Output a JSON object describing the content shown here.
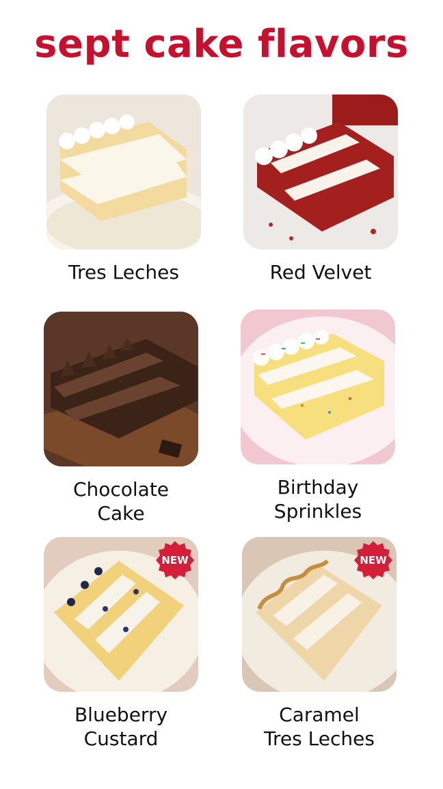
{
  "header": {
    "title": "sept cake flavors"
  },
  "flavors": [
    {
      "line1": "Tres Leches",
      "line2": "",
      "badge": ""
    },
    {
      "line1": "Red Velvet",
      "line2": "",
      "badge": ""
    },
    {
      "line1": "Chocolate",
      "line2": "Cake",
      "badge": ""
    },
    {
      "line1": "Birthday",
      "line2": "Sprinkles",
      "badge": ""
    },
    {
      "line1": "Blueberry",
      "line2": "Custard",
      "badge": "NEW"
    },
    {
      "line1": "Caramel",
      "line2": "Tres Leches",
      "badge": "NEW"
    }
  ],
  "colors": {
    "brand_red": "#c8102e",
    "badge_red": "#d41f3a",
    "text": "#111111"
  }
}
